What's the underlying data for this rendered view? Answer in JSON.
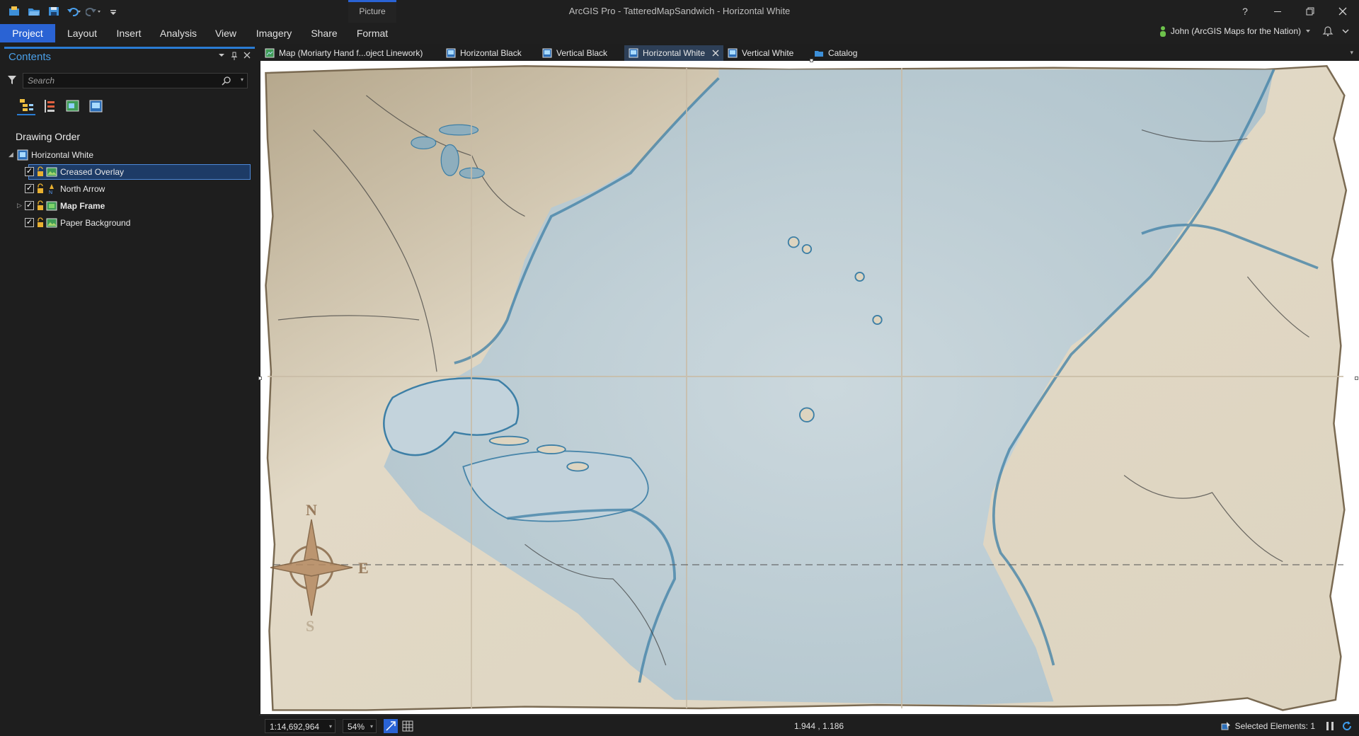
{
  "app": {
    "window_title": "ArcGIS Pro - TatteredMapSandwich - Horizontal White",
    "contextual_tab_group": "Picture",
    "help_glyph": "?"
  },
  "ribbon": {
    "tabs": [
      {
        "label": "Project",
        "active": true
      },
      {
        "label": "Layout"
      },
      {
        "label": "Insert"
      },
      {
        "label": "Analysis"
      },
      {
        "label": "View"
      },
      {
        "label": "Imagery"
      },
      {
        "label": "Share"
      },
      {
        "label": "Format"
      }
    ],
    "user": "John (ArcGIS Maps for the Nation)"
  },
  "contents": {
    "title": "Contents",
    "search_placeholder": "Search",
    "section_title": "Drawing Order",
    "root": "Horizontal White",
    "layers": [
      {
        "label": "Creased Overlay",
        "checked": true,
        "selected": true,
        "bold": false,
        "expandable": false,
        "icon": "picture-layer-icon"
      },
      {
        "label": "North Arrow",
        "checked": true,
        "selected": false,
        "bold": false,
        "expandable": false,
        "icon": "north-arrow-icon"
      },
      {
        "label": "Map Frame",
        "checked": true,
        "selected": false,
        "bold": true,
        "expandable": true,
        "icon": "map-frame-icon"
      },
      {
        "label": "Paper Background",
        "checked": true,
        "selected": false,
        "bold": false,
        "expandable": false,
        "icon": "picture-layer-icon"
      }
    ],
    "check_glyph": "✓"
  },
  "doc_tabs": [
    {
      "label": "Map (Moriarty Hand f...oject Linework)",
      "icon": "map-icon",
      "active": false
    },
    {
      "label": "Horizontal Black",
      "icon": "layout-icon",
      "active": false
    },
    {
      "label": "Vertical Black",
      "icon": "layout-icon",
      "active": false
    },
    {
      "label": "Horizontal White",
      "icon": "layout-icon",
      "active": true
    },
    {
      "label": "Vertical White",
      "icon": "layout-icon",
      "active": false
    },
    {
      "label": "Catalog",
      "icon": "catalog-icon",
      "active": false
    }
  ],
  "map": {
    "compass_letters": {
      "n": "N",
      "e": "E",
      "s": "S"
    },
    "colors": {
      "paper": "#e3dccb",
      "ocean": "#bccfd8",
      "coast": "#3d7fa6",
      "line": "#3a3a3a"
    }
  },
  "status": {
    "scale": "1:14,692,964",
    "zoom": "54%",
    "coords": "1.944 , 1.186",
    "selected": "Selected Elements: 1"
  }
}
